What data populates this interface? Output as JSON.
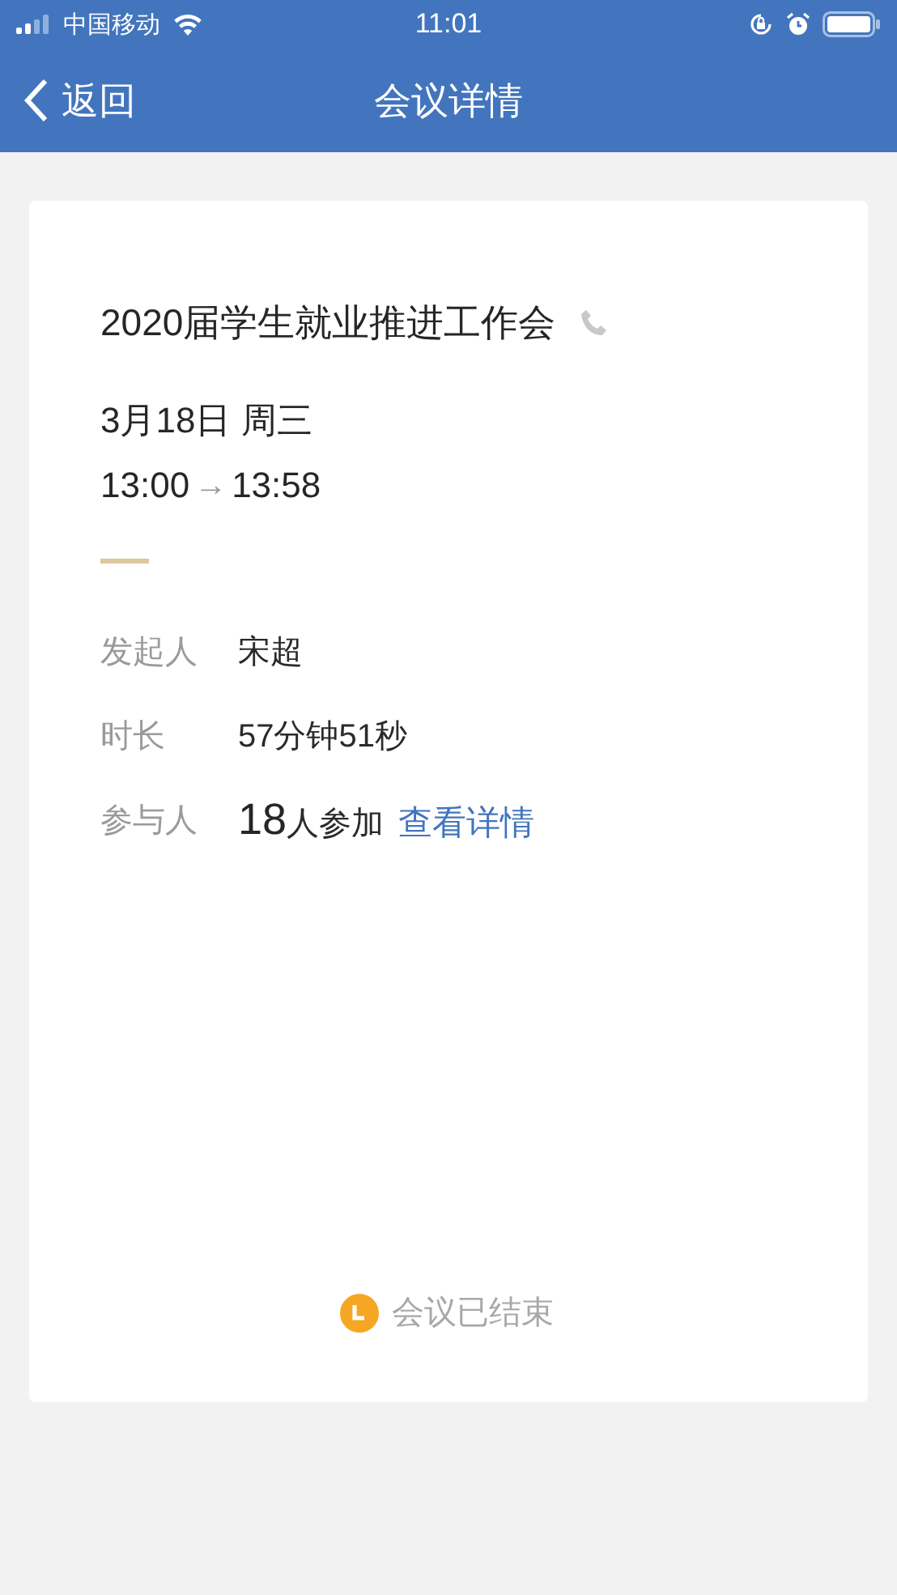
{
  "status_bar": {
    "carrier": "中国移动",
    "time": "11:01"
  },
  "nav": {
    "back": "返回",
    "title": "会议详情"
  },
  "meeting": {
    "title": "2020届学生就业推进工作会",
    "date": "3月18日 周三",
    "start": "13:00",
    "arrow": "→",
    "end": "13:58"
  },
  "details": [
    {
      "kind": "text",
      "label": "发起人",
      "value": "宋超"
    },
    {
      "kind": "text",
      "label": "时长",
      "value": "57分钟51秒"
    },
    {
      "kind": "participants",
      "label": "参与人",
      "count": "18",
      "suffix": "人参加",
      "link": "查看详情"
    }
  ],
  "footer": {
    "status": "会议已结束"
  }
}
